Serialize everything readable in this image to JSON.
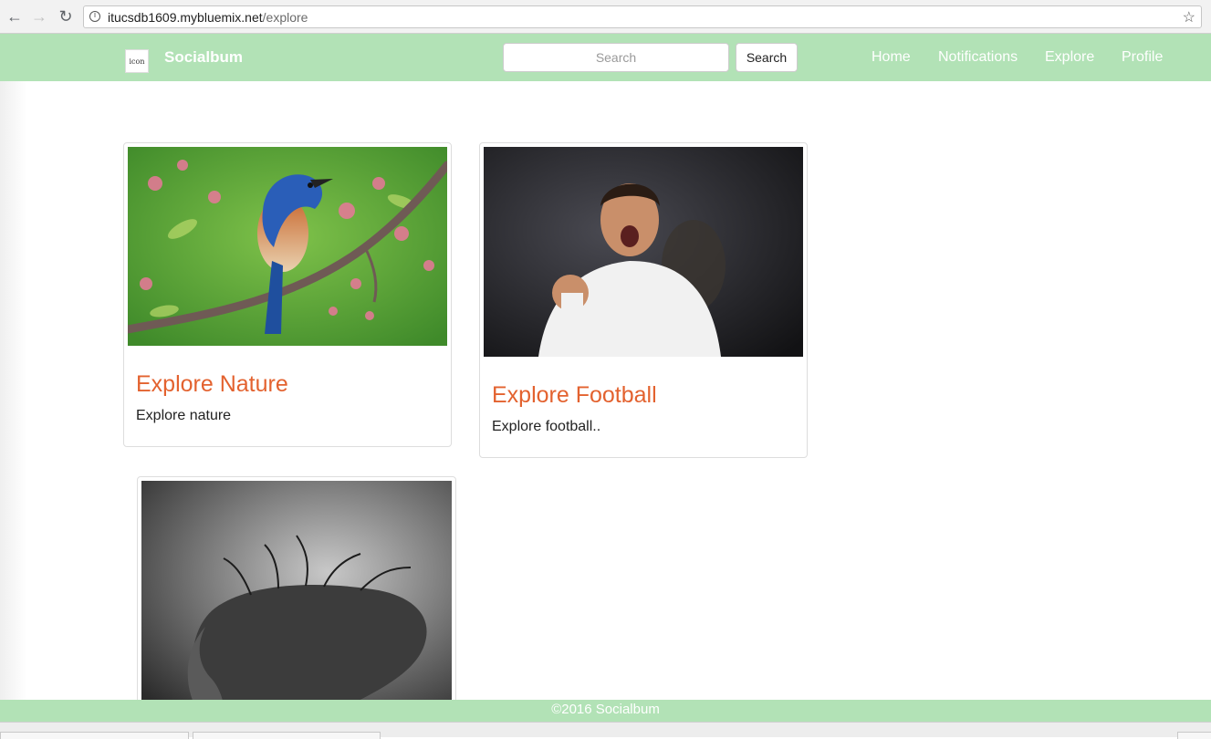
{
  "browser": {
    "url_host": "itucsdb1609.mybluemix.net",
    "url_path": "/explore"
  },
  "navbar": {
    "logo_text": "icon",
    "brand": "Socialbum",
    "search_placeholder": "Search",
    "search_button": "Search",
    "links": [
      "Home",
      "Notifications",
      "Explore",
      "Profile"
    ],
    "background_color": "#b2e2b6"
  },
  "cards": [
    {
      "image": "bird-photo",
      "title": "Explore Nature",
      "description": "Explore nature"
    },
    {
      "image": "football-player-photo",
      "title": "Explore Football",
      "description": "Explore football.."
    },
    {
      "image": "art-face-tree-photo",
      "title": "",
      "description": ""
    }
  ],
  "accent_color": "#e3622f",
  "footer": {
    "text": "©2016 Socialbum"
  }
}
